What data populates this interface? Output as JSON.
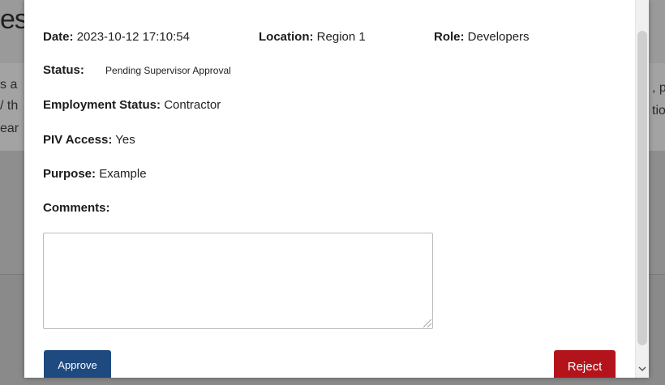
{
  "background": {
    "title_fragment": "es",
    "left_text_lines": [
      "s a",
      "/ th",
      "ear"
    ],
    "right_text_lines": [
      ", p",
      "tior"
    ]
  },
  "modal": {
    "date": {
      "label": "Date:",
      "value": "2023-10-12 17:10:54"
    },
    "location": {
      "label": "Location:",
      "value": "Region 1"
    },
    "role": {
      "label": "Role:",
      "value": "Developers"
    },
    "status": {
      "label": "Status:",
      "value": "Pending Supervisor Approval"
    },
    "employment_status": {
      "label": "Employment Status:",
      "value": "Contractor"
    },
    "piv_access": {
      "label": "PIV Access:",
      "value": "Yes"
    },
    "purpose": {
      "label": "Purpose:",
      "value": "Example"
    },
    "comments": {
      "label": "Comments:",
      "value": ""
    },
    "approve_label": "Approve",
    "reject_label": "Reject"
  },
  "colors": {
    "approve": "#1e4a80",
    "reject": "#b3141b"
  },
  "icons": {
    "scroll_down": "chevron-down-icon",
    "resize": "resize-grip-icon"
  }
}
